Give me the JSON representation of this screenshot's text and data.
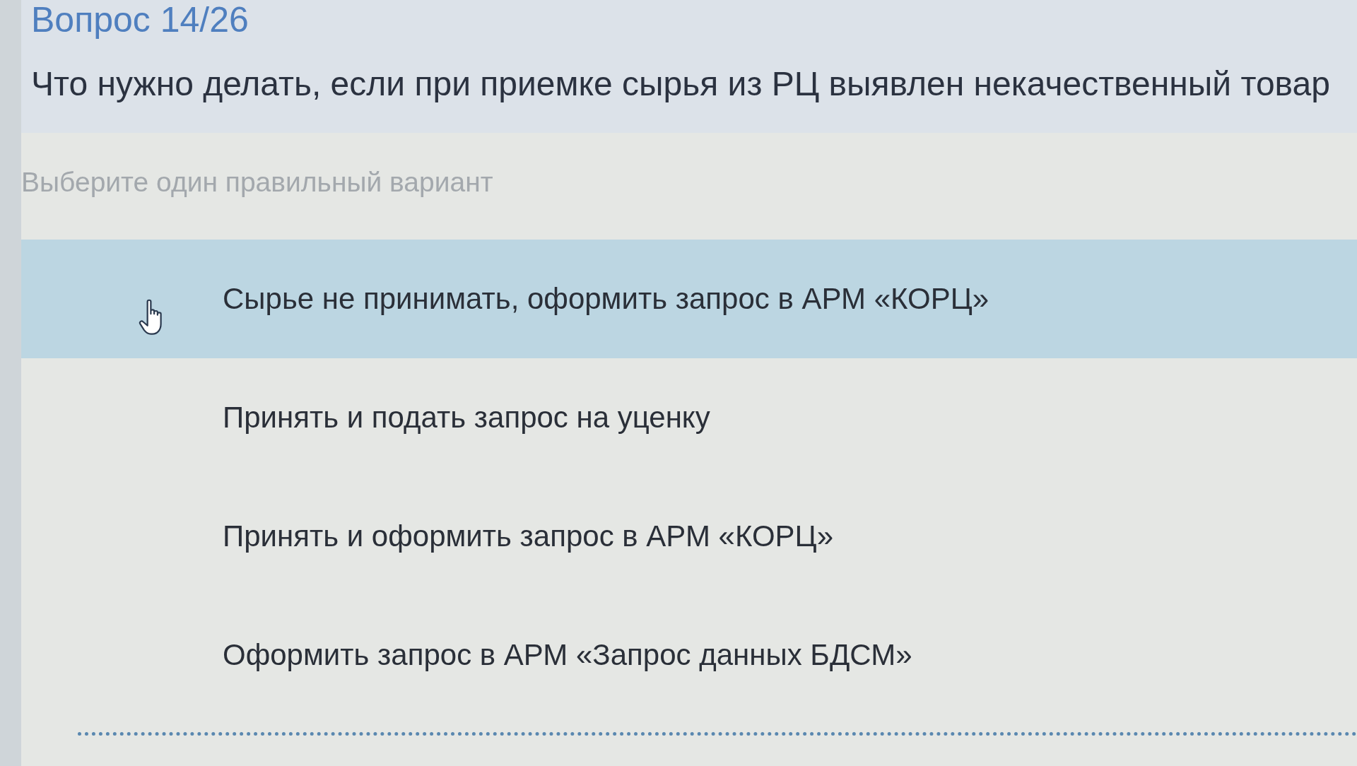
{
  "quiz": {
    "counter": "Вопрос 14/26",
    "question": "Что нужно делать, если при приемке сырья из РЦ выявлен некачественный товар",
    "instruction": "Выберите один правильный вариант",
    "options": [
      {
        "label": "Сырье не принимать, оформить запрос в АРМ «КОРЦ»",
        "selected": true
      },
      {
        "label": "Принять и подать запрос на уценку",
        "selected": false
      },
      {
        "label": "Принять и оформить запрос в АРМ «КОРЦ»",
        "selected": false
      },
      {
        "label": "Оформить запрос в АРМ «Запрос данных БДСМ»",
        "selected": false
      }
    ]
  }
}
